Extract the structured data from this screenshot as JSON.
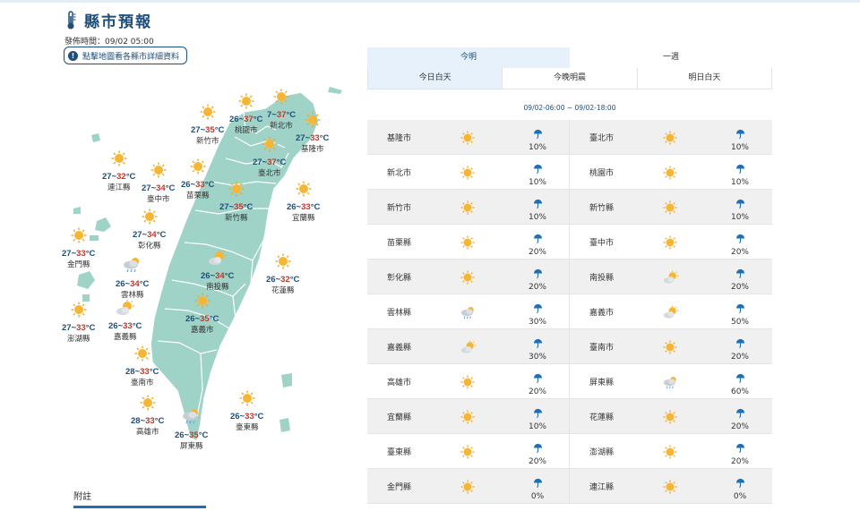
{
  "header": {
    "title": "縣市預報",
    "published": "發佈時間：09/02 05:00",
    "map_button": "點擊地圖看各縣市詳細資料"
  },
  "map_cities": [
    {
      "name": "臺北市",
      "low": "27",
      "high": "37",
      "unit": "°C",
      "icon": "sunny"
    },
    {
      "name": "新北市",
      "low": "7",
      "high": "37",
      "unit": "°C",
      "icon": "sunny"
    },
    {
      "name": "基隆市",
      "low": "27",
      "high": "33",
      "unit": "°C",
      "icon": "sunny"
    },
    {
      "name": "桃園市",
      "low": "26",
      "high": "37",
      "unit": "°C",
      "icon": "sunny"
    },
    {
      "name": "新竹市",
      "low": "27",
      "high": "35",
      "unit": "°C",
      "icon": "sunny"
    },
    {
      "name": "新竹縣",
      "low": "27",
      "high": "35",
      "unit": "°C",
      "icon": "sunny"
    },
    {
      "name": "苗栗縣",
      "low": "26",
      "high": "33",
      "unit": "°C",
      "icon": "sunny"
    },
    {
      "name": "臺中市",
      "low": "27",
      "high": "34",
      "unit": "°C",
      "icon": "sunny"
    },
    {
      "name": "宜蘭縣",
      "low": "26",
      "high": "33",
      "unit": "°C",
      "icon": "sunny"
    },
    {
      "name": "連江縣",
      "low": "27",
      "high": "32",
      "unit": "°C",
      "icon": "sunny"
    },
    {
      "name": "彰化縣",
      "low": "27",
      "high": "34",
      "unit": "°C",
      "icon": "sunny"
    },
    {
      "name": "金門縣",
      "low": "27",
      "high": "33",
      "unit": "°C",
      "icon": "sunny"
    },
    {
      "name": "南投縣",
      "low": "26",
      "high": "34",
      "unit": "°C",
      "icon": "partly-cloudy"
    },
    {
      "name": "花蓮縣",
      "low": "26",
      "high": "32",
      "unit": "°C",
      "icon": "sunny"
    },
    {
      "name": "雲林縣",
      "low": "26",
      "high": "34",
      "unit": "°C",
      "icon": "cloudy-rain"
    },
    {
      "name": "嘉義市",
      "low": "26",
      "high": "35",
      "unit": "°C",
      "icon": "sunny"
    },
    {
      "name": "嘉義縣",
      "low": "26",
      "high": "33",
      "unit": "°C",
      "icon": "partly-cloudy"
    },
    {
      "name": "澎湖縣",
      "low": "27",
      "high": "33",
      "unit": "°C",
      "icon": "sunny"
    },
    {
      "name": "臺南市",
      "low": "28",
      "high": "33",
      "unit": "°C",
      "icon": "sunny"
    },
    {
      "name": "高雄市",
      "low": "28",
      "high": "33",
      "unit": "°C",
      "icon": "sunny"
    },
    {
      "name": "屏東縣",
      "low": "26",
      "high": "35",
      "unit": "°C",
      "icon": "cloudy-rain"
    },
    {
      "name": "臺東縣",
      "low": "26",
      "high": "33",
      "unit": "°C",
      "icon": "sunny"
    }
  ],
  "tabs_top": [
    {
      "label": "今明",
      "active": true
    },
    {
      "label": "一週",
      "active": false
    }
  ],
  "tabs_period": [
    {
      "label": "今日白天",
      "active": true
    },
    {
      "label": "今晚明晨",
      "active": false
    },
    {
      "label": "明日白天",
      "active": false
    }
  ],
  "period_range": "09/02-06:00 ~ 09/02-18:00",
  "table": [
    [
      {
        "name": "基隆市",
        "icon": "sunny",
        "rain": "10%"
      },
      {
        "name": "臺北市",
        "icon": "sunny",
        "rain": "10%"
      }
    ],
    [
      {
        "name": "新北市",
        "icon": "sunny",
        "rain": "10%"
      },
      {
        "name": "桃園市",
        "icon": "sunny",
        "rain": "10%"
      }
    ],
    [
      {
        "name": "新竹市",
        "icon": "sunny",
        "rain": "10%"
      },
      {
        "name": "新竹縣",
        "icon": "sunny",
        "rain": "10%"
      }
    ],
    [
      {
        "name": "苗栗縣",
        "icon": "sunny",
        "rain": "20%"
      },
      {
        "name": "臺中市",
        "icon": "sunny",
        "rain": "20%"
      }
    ],
    [
      {
        "name": "彰化縣",
        "icon": "sunny",
        "rain": "20%"
      },
      {
        "name": "南投縣",
        "icon": "partly-cloudy",
        "rain": "20%"
      }
    ],
    [
      {
        "name": "雲林縣",
        "icon": "cloudy-rain",
        "rain": "30%"
      },
      {
        "name": "嘉義市",
        "icon": "partly-cloudy",
        "rain": "50%"
      }
    ],
    [
      {
        "name": "嘉義縣",
        "icon": "partly-cloudy",
        "rain": "30%"
      },
      {
        "name": "臺南市",
        "icon": "sunny",
        "rain": "20%"
      }
    ],
    [
      {
        "name": "高雄市",
        "icon": "sunny",
        "rain": "20%"
      },
      {
        "name": "屏東縣",
        "icon": "cloudy-rain",
        "rain": "60%"
      }
    ],
    [
      {
        "name": "宜蘭縣",
        "icon": "sunny",
        "rain": "10%"
      },
      {
        "name": "花蓮縣",
        "icon": "sunny",
        "rain": "20%"
      }
    ],
    [
      {
        "name": "臺東縣",
        "icon": "sunny",
        "rain": "20%"
      },
      {
        "name": "澎湖縣",
        "icon": "sunny",
        "rain": "20%"
      }
    ],
    [
      {
        "name": "金門縣",
        "icon": "sunny",
        "rain": "0%"
      },
      {
        "name": "連江縣",
        "icon": "sunny",
        "rain": "0%"
      }
    ]
  ],
  "notes_label": "附註",
  "colors": {
    "brand": "#1f4e79",
    "high_temp": "#c0392b",
    "map_land": "#9fd3c7",
    "active_tab": "#e6f1fb",
    "sun": "#f5a623"
  }
}
